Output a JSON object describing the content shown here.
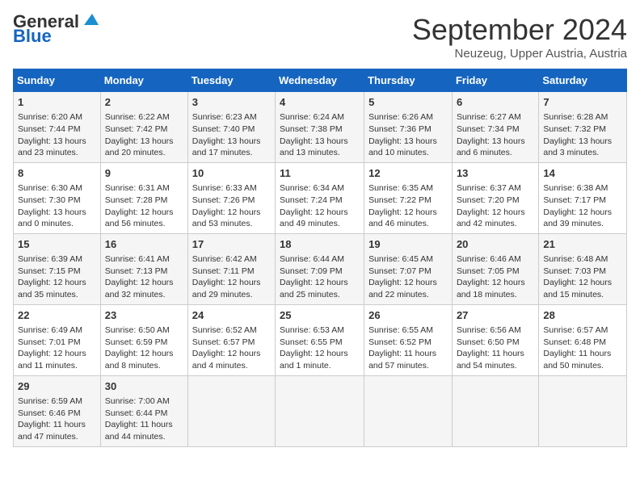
{
  "header": {
    "logo_line1": "General",
    "logo_line2": "Blue",
    "title": "September 2024",
    "location": "Neuzeug, Upper Austria, Austria"
  },
  "weekdays": [
    "Sunday",
    "Monday",
    "Tuesday",
    "Wednesday",
    "Thursday",
    "Friday",
    "Saturday"
  ],
  "weeks": [
    [
      {
        "day": "1",
        "info": "Sunrise: 6:20 AM\nSunset: 7:44 PM\nDaylight: 13 hours\nand 23 minutes."
      },
      {
        "day": "2",
        "info": "Sunrise: 6:22 AM\nSunset: 7:42 PM\nDaylight: 13 hours\nand 20 minutes."
      },
      {
        "day": "3",
        "info": "Sunrise: 6:23 AM\nSunset: 7:40 PM\nDaylight: 13 hours\nand 17 minutes."
      },
      {
        "day": "4",
        "info": "Sunrise: 6:24 AM\nSunset: 7:38 PM\nDaylight: 13 hours\nand 13 minutes."
      },
      {
        "day": "5",
        "info": "Sunrise: 6:26 AM\nSunset: 7:36 PM\nDaylight: 13 hours\nand 10 minutes."
      },
      {
        "day": "6",
        "info": "Sunrise: 6:27 AM\nSunset: 7:34 PM\nDaylight: 13 hours\nand 6 minutes."
      },
      {
        "day": "7",
        "info": "Sunrise: 6:28 AM\nSunset: 7:32 PM\nDaylight: 13 hours\nand 3 minutes."
      }
    ],
    [
      {
        "day": "8",
        "info": "Sunrise: 6:30 AM\nSunset: 7:30 PM\nDaylight: 13 hours\nand 0 minutes."
      },
      {
        "day": "9",
        "info": "Sunrise: 6:31 AM\nSunset: 7:28 PM\nDaylight: 12 hours\nand 56 minutes."
      },
      {
        "day": "10",
        "info": "Sunrise: 6:33 AM\nSunset: 7:26 PM\nDaylight: 12 hours\nand 53 minutes."
      },
      {
        "day": "11",
        "info": "Sunrise: 6:34 AM\nSunset: 7:24 PM\nDaylight: 12 hours\nand 49 minutes."
      },
      {
        "day": "12",
        "info": "Sunrise: 6:35 AM\nSunset: 7:22 PM\nDaylight: 12 hours\nand 46 minutes."
      },
      {
        "day": "13",
        "info": "Sunrise: 6:37 AM\nSunset: 7:20 PM\nDaylight: 12 hours\nand 42 minutes."
      },
      {
        "day": "14",
        "info": "Sunrise: 6:38 AM\nSunset: 7:17 PM\nDaylight: 12 hours\nand 39 minutes."
      }
    ],
    [
      {
        "day": "15",
        "info": "Sunrise: 6:39 AM\nSunset: 7:15 PM\nDaylight: 12 hours\nand 35 minutes."
      },
      {
        "day": "16",
        "info": "Sunrise: 6:41 AM\nSunset: 7:13 PM\nDaylight: 12 hours\nand 32 minutes."
      },
      {
        "day": "17",
        "info": "Sunrise: 6:42 AM\nSunset: 7:11 PM\nDaylight: 12 hours\nand 29 minutes."
      },
      {
        "day": "18",
        "info": "Sunrise: 6:44 AM\nSunset: 7:09 PM\nDaylight: 12 hours\nand 25 minutes."
      },
      {
        "day": "19",
        "info": "Sunrise: 6:45 AM\nSunset: 7:07 PM\nDaylight: 12 hours\nand 22 minutes."
      },
      {
        "day": "20",
        "info": "Sunrise: 6:46 AM\nSunset: 7:05 PM\nDaylight: 12 hours\nand 18 minutes."
      },
      {
        "day": "21",
        "info": "Sunrise: 6:48 AM\nSunset: 7:03 PM\nDaylight: 12 hours\nand 15 minutes."
      }
    ],
    [
      {
        "day": "22",
        "info": "Sunrise: 6:49 AM\nSunset: 7:01 PM\nDaylight: 12 hours\nand 11 minutes."
      },
      {
        "day": "23",
        "info": "Sunrise: 6:50 AM\nSunset: 6:59 PM\nDaylight: 12 hours\nand 8 minutes."
      },
      {
        "day": "24",
        "info": "Sunrise: 6:52 AM\nSunset: 6:57 PM\nDaylight: 12 hours\nand 4 minutes."
      },
      {
        "day": "25",
        "info": "Sunrise: 6:53 AM\nSunset: 6:55 PM\nDaylight: 12 hours\nand 1 minute."
      },
      {
        "day": "26",
        "info": "Sunrise: 6:55 AM\nSunset: 6:52 PM\nDaylight: 11 hours\nand 57 minutes."
      },
      {
        "day": "27",
        "info": "Sunrise: 6:56 AM\nSunset: 6:50 PM\nDaylight: 11 hours\nand 54 minutes."
      },
      {
        "day": "28",
        "info": "Sunrise: 6:57 AM\nSunset: 6:48 PM\nDaylight: 11 hours\nand 50 minutes."
      }
    ],
    [
      {
        "day": "29",
        "info": "Sunrise: 6:59 AM\nSunset: 6:46 PM\nDaylight: 11 hours\nand 47 minutes."
      },
      {
        "day": "30",
        "info": "Sunrise: 7:00 AM\nSunset: 6:44 PM\nDaylight: 11 hours\nand 44 minutes."
      },
      {
        "day": "",
        "info": ""
      },
      {
        "day": "",
        "info": ""
      },
      {
        "day": "",
        "info": ""
      },
      {
        "day": "",
        "info": ""
      },
      {
        "day": "",
        "info": ""
      }
    ]
  ]
}
